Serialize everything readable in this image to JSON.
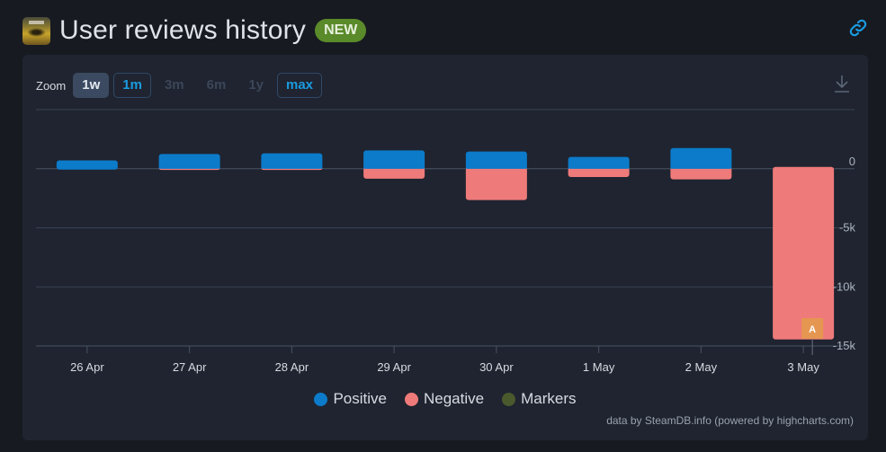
{
  "header": {
    "title": "User reviews history",
    "badge": "NEW",
    "icons": {
      "game": "game-capsule-icon",
      "link": "link-icon"
    }
  },
  "toolbar": {
    "zoom_label": "Zoom",
    "buttons": [
      {
        "label": "1w",
        "state": "active"
      },
      {
        "label": "1m",
        "state": "outlined"
      },
      {
        "label": "3m",
        "state": "disabled"
      },
      {
        "label": "6m",
        "state": "disabled"
      },
      {
        "label": "1y",
        "state": "disabled"
      },
      {
        "label": "max",
        "state": "outlined"
      }
    ],
    "download_icon": "download-icon"
  },
  "colors": {
    "positive": "#0c7bc9",
    "negative": "#ef7a7a",
    "markers": "#4b5a2d",
    "marker_badge": "#e39a4e",
    "grid": "#3a4252",
    "background": "#1f2430"
  },
  "chart_data": {
    "type": "bar",
    "title": "User reviews history",
    "categories": [
      "26 Apr",
      "27 Apr",
      "28 Apr",
      "29 Apr",
      "30 Apr",
      "1 May",
      "2 May",
      "3 May"
    ],
    "series": [
      {
        "name": "Positive",
        "values": [
          700,
          1250,
          1300,
          1550,
          1450,
          1000,
          1750,
          0
        ]
      },
      {
        "name": "Negative",
        "values": [
          0,
          -100,
          -100,
          -850,
          -2650,
          -700,
          -900,
          -14450
        ]
      },
      {
        "name": "Markers",
        "values": [
          null,
          null,
          null,
          null,
          null,
          null,
          null,
          "A"
        ]
      }
    ],
    "y_ticks": [
      "0",
      "-5k",
      "-10k",
      "-15k"
    ],
    "y_tick_values": [
      0,
      -5000,
      -10000,
      -15000
    ],
    "ylim": [
      -15000,
      5000
    ],
    "grid": true,
    "legend": {
      "position": "bottom-center",
      "entries": [
        "Positive",
        "Negative",
        "Markers"
      ]
    },
    "annotations": [
      {
        "category": "3 May",
        "label": "A"
      }
    ],
    "xlabel": "",
    "ylabel": ""
  },
  "credits": "data by SteamDB.info (powered by highcharts.com)"
}
